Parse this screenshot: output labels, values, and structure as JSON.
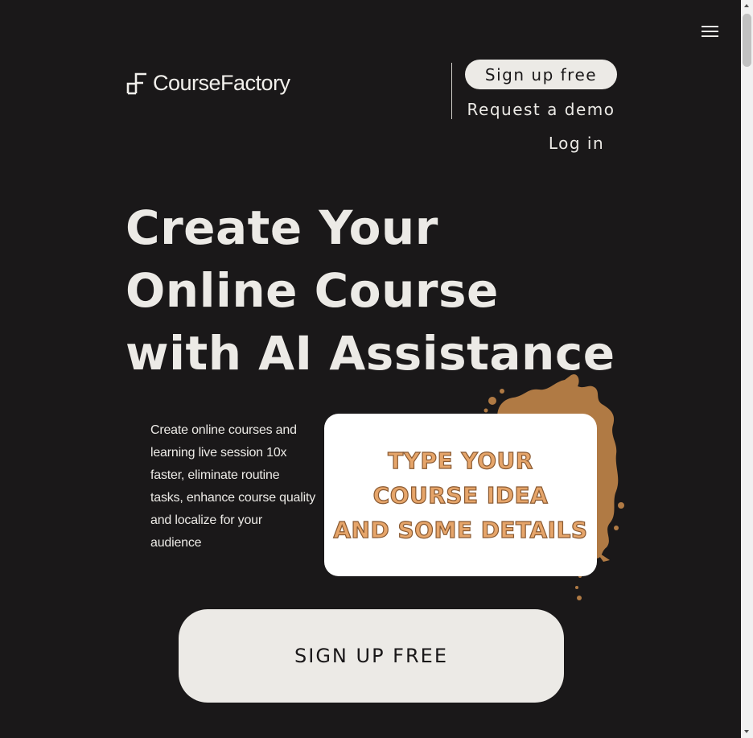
{
  "header": {
    "logo_text": "CourseFactory",
    "menu_icon": "hamburger-menu-icon",
    "nav": {
      "signup_label": "Sign up free",
      "demo_label": "Request a demo",
      "login_label": "Log in"
    }
  },
  "hero": {
    "title_lines": [
      "Create Your",
      "Online Course",
      "with AI Assistance"
    ],
    "description": "Create online courses and learning live session 10x faster, eliminate routine tasks, enhance course quality and localize for your audience",
    "demo_card_lines": [
      "TYPE YOUR",
      "COURSE IDEA",
      "AND SOME DETAILS"
    ],
    "cta_label": "SIGN UP FREE"
  },
  "colors": {
    "background": "#1a1819",
    "foreground": "#eceae6",
    "accent_orange": "#e6a56a",
    "splash_brown": "#b07a44"
  }
}
